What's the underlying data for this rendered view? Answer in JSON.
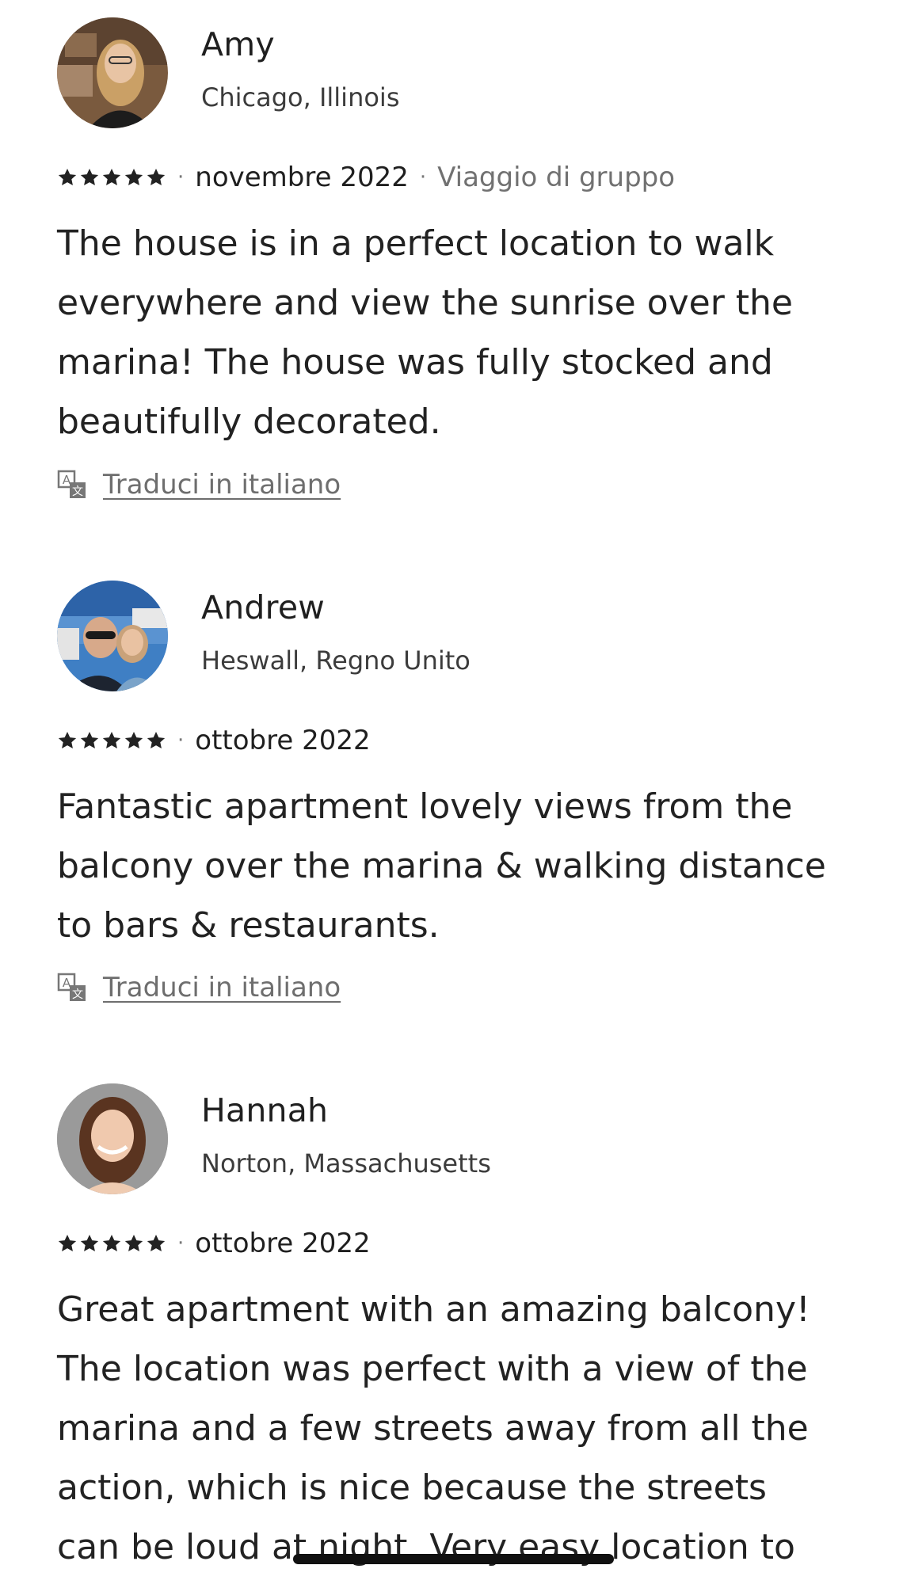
{
  "reviews": [
    {
      "name": "Amy",
      "location": "Chicago, Illinois",
      "rating": 5,
      "date": "novembre 2022",
      "trip_type": "Viaggio di gruppo",
      "text_lines": [
        "The house is in a perfect location to walk",
        "everywhere and view the sunrise over the",
        "marina! The house was fully stocked and",
        "beautifully decorated."
      ],
      "translate_label": "Traduci in italiano"
    },
    {
      "name": "Andrew",
      "location": "Heswall, Regno Unito",
      "rating": 5,
      "date": "ottobre 2022",
      "text_lines": [
        "Fantastic apartment lovely views from the",
        "balcony over the marina & walking distance",
        "to bars & restaurants."
      ],
      "translate_label": "Traduci in italiano"
    },
    {
      "name": "Hannah",
      "location": "Norton, Massachusetts",
      "rating": 5,
      "date": "ottobre 2022",
      "text_lines": [
        "Great apartment with an amazing balcony!",
        "The location was perfect with a view of the",
        "marina and a few streets away from all the",
        "action, which is nice because the streets",
        "can be loud at night. Very easy location to"
      ]
    }
  ],
  "icons": {
    "star": "star-icon",
    "translate": "translate-icon"
  },
  "colors": {
    "text": "#222222",
    "muted": "#717171",
    "star": "#222222"
  }
}
